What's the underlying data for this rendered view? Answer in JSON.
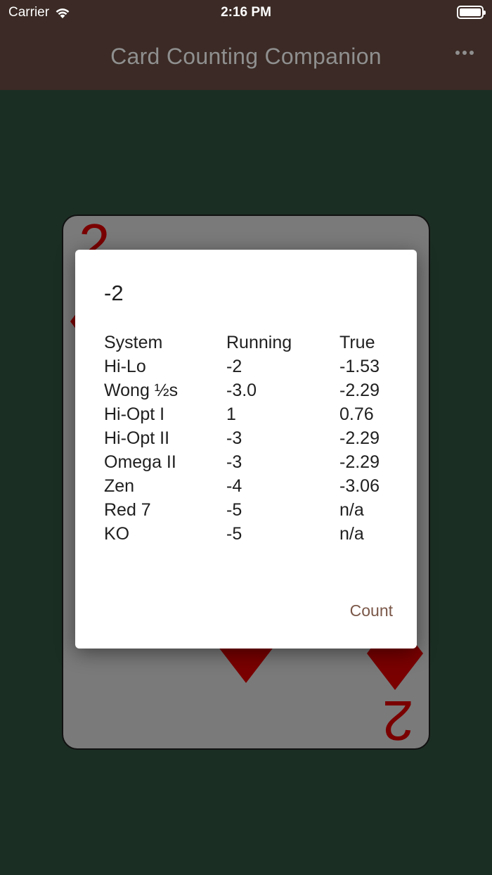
{
  "status_bar": {
    "carrier": "Carrier",
    "time": "2:16 PM"
  },
  "app_bar": {
    "title": "Card Counting Companion"
  },
  "card": {
    "rank": "2",
    "suit": "diamond",
    "color": "#7a0000"
  },
  "dialog": {
    "title": "-2",
    "headers": [
      "System",
      "Running",
      "True"
    ],
    "rows": [
      [
        "Hi-Lo",
        "-2",
        "-1.53"
      ],
      [
        "Wong ½s",
        "-3.0",
        "-2.29"
      ],
      [
        "Hi-Opt I",
        "1",
        "0.76"
      ],
      [
        "Hi-Opt II",
        "-3",
        "-2.29"
      ],
      [
        "Omega II",
        "-3",
        "-2.29"
      ],
      [
        "Zen",
        "-4",
        "-3.06"
      ],
      [
        "Red 7",
        "-5",
        "n/a"
      ],
      [
        "KO",
        "-5",
        "n/a"
      ]
    ],
    "action_label": "Count"
  },
  "colors": {
    "app_bar": "#3b2a25",
    "table_felt": "#1b2e24",
    "accent": "#7a5748"
  }
}
